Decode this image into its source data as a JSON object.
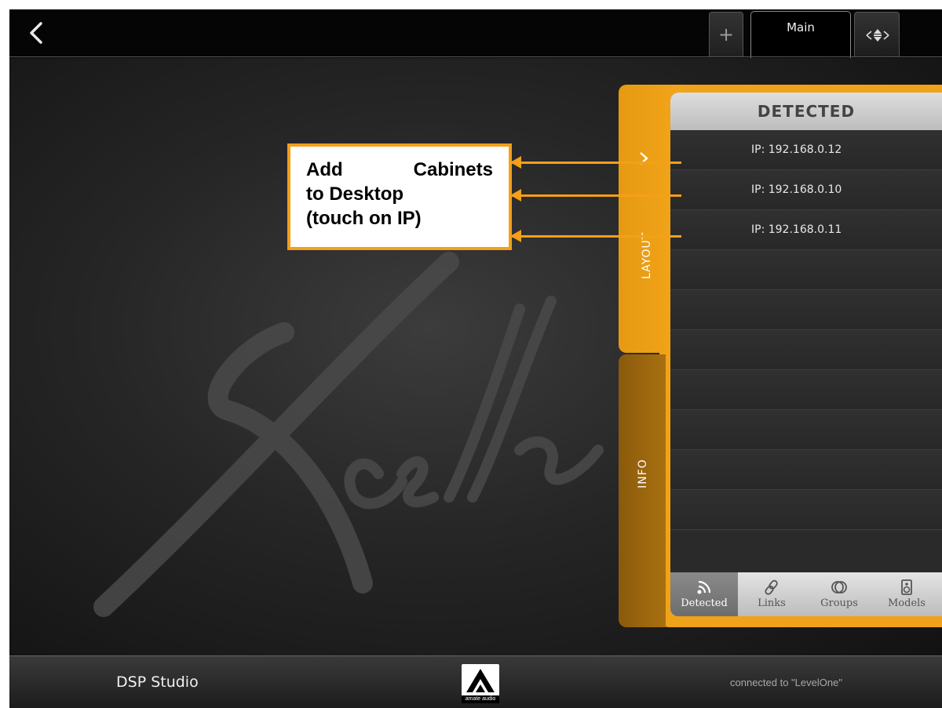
{
  "topbar": {
    "back_icon": "chevron-left-icon",
    "tabs": [
      {
        "label": "+",
        "icon": "plus-icon"
      },
      {
        "label": "Main"
      },
      {
        "icon": "move-arrows-icon"
      }
    ]
  },
  "sidebar_tabs": {
    "layout_label": "LAYOUT",
    "info_label": "INFO",
    "collapse_icon": "chevron-right-icon"
  },
  "panel": {
    "title": "DETECTED",
    "rows": [
      {
        "label": "IP: 192.168.0.12"
      },
      {
        "label": "IP: 192.168.0.10"
      },
      {
        "label": "IP: 192.168.0.11"
      },
      {
        "label": ""
      },
      {
        "label": ""
      },
      {
        "label": ""
      },
      {
        "label": ""
      },
      {
        "label": ""
      },
      {
        "label": ""
      },
      {
        "label": ""
      },
      {
        "label": ""
      }
    ],
    "footer_tabs": [
      {
        "label": "Detected",
        "icon": "signal-icon",
        "active": true
      },
      {
        "label": "Links",
        "icon": "link-icon",
        "active": false
      },
      {
        "label": "Groups",
        "icon": "rings-icon",
        "active": false
      },
      {
        "label": "Models",
        "icon": "speaker-icon",
        "active": false
      }
    ]
  },
  "callout": {
    "line1_word1": "Add",
    "line1_word2": "Cabinets",
    "line2": "to Desktop",
    "line3": "(touch on IP)"
  },
  "watermark": {
    "text": "Xcelle"
  },
  "bottombar": {
    "app_name": "DSP Studio",
    "logo_text": "amate audio",
    "connection_status": "connected to \"LevelOne\""
  },
  "colors": {
    "accent": "#f4a019",
    "accent_dark": "#a9700f",
    "background": "#000000"
  }
}
